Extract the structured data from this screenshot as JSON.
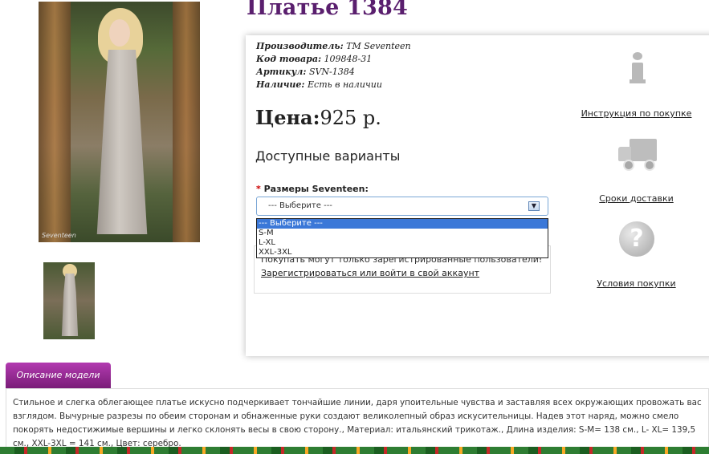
{
  "product": {
    "title": "Платье 1384",
    "specs": [
      {
        "label": "Производитель:",
        "value": "TM Seventeen"
      },
      {
        "label": "Код товара:",
        "value": "109848-31"
      },
      {
        "label": "Артикул:",
        "value": "SVN-1384"
      },
      {
        "label": "Наличие:",
        "value": "Есть в наличии"
      }
    ],
    "price_label": "Цена:",
    "price_value": "925 р.",
    "options_heading": "Доступные варианты",
    "size_required_mark": "*",
    "size_label": "Размеры Seventeen:",
    "size_select": {
      "selected": "--- Выберите ---",
      "options": [
        "--- Выберите ---",
        "S-M",
        "L-XL",
        "XXL-3XL"
      ]
    },
    "notice_text": "Покупать могут только зарегистрированные пользователи!",
    "notice_link": "Зарегистрироваться или войти в свой аккаунт",
    "image_watermark": "Seventeen"
  },
  "sidebar": {
    "instruction_link": "Инструкция по покупке",
    "delivery_link": "Сроки доставки",
    "conditions_link": "Условия покупки",
    "icons": [
      "info-icon",
      "truck-icon",
      "question-icon"
    ]
  },
  "description": {
    "tab_label": "Описание модели",
    "text": "Стильное и слегка облегающее платье искусно подчеркивает тончайшие линии, даря упоительные чувства и заставляя всех окружающих провожать вас взглядом. Вычурные разрезы по обеим сторонам и обнаженные руки создают великолепный образ искусительницы. Надев этот наряд, можно смело покорять недостижимые вершины и легко склонять весы в свою сторону., Материал: итальянский трикотаж., Длина изделия: S-M= 138 см., L- XL= 139,5 см., XXL-3XL = 141 см., Цвет: серебро."
  },
  "colors": {
    "title": "#5a1f6e",
    "tab": "#9a2b98",
    "select_highlight": "#3b78d8"
  }
}
